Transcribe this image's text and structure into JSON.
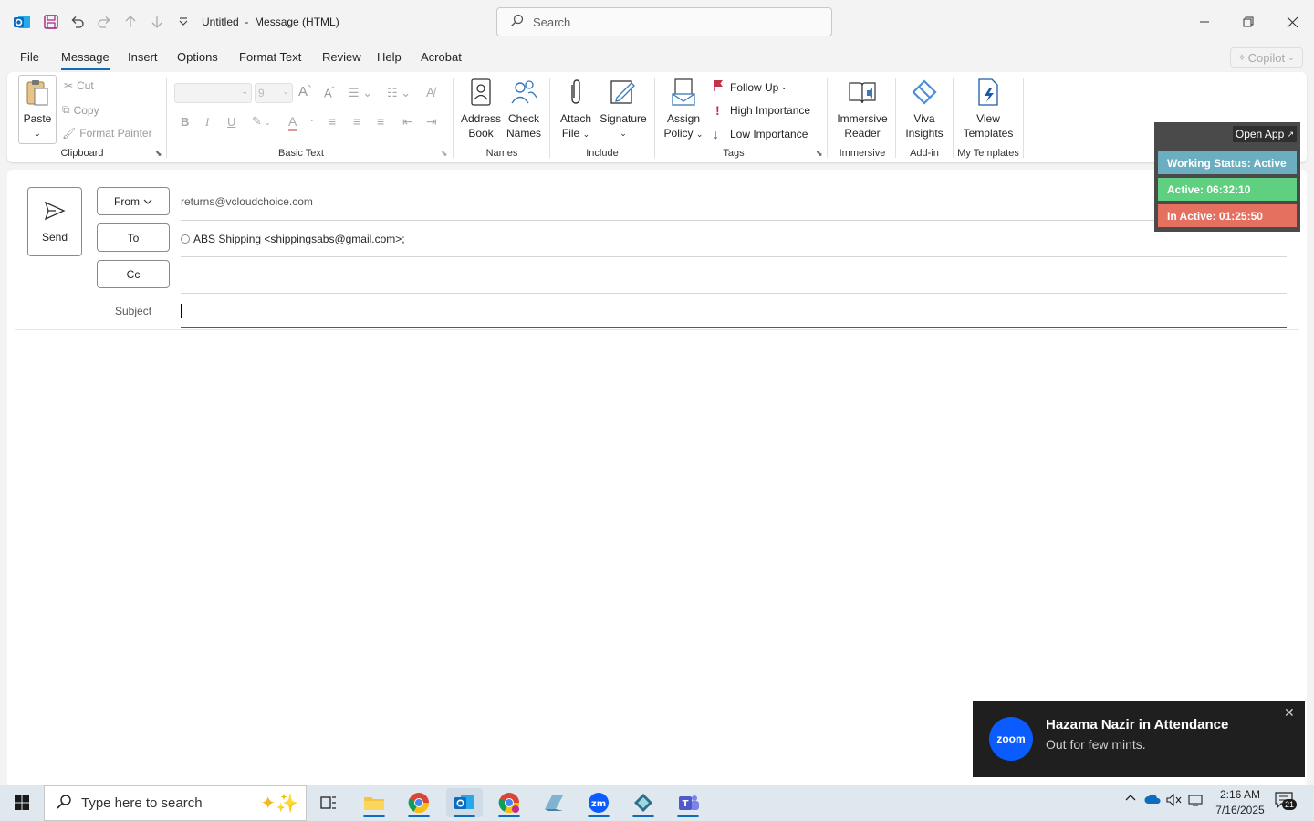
{
  "titlebar": {
    "title": "Untitled",
    "separator": "-",
    "subtitle": "Message (HTML)",
    "search_placeholder": "Search"
  },
  "menu": {
    "tabs": [
      "File",
      "Message",
      "Insert",
      "Options",
      "Format Text",
      "Review",
      "Help",
      "Acrobat"
    ],
    "active": "Message",
    "copilot": "Copilot"
  },
  "ribbon": {
    "clipboard": {
      "paste": "Paste",
      "cut": "Cut",
      "copy": "Copy",
      "format_painter": "Format Painter",
      "label": "Clipboard"
    },
    "basic_text": {
      "font_size": "9",
      "label": "Basic Text"
    },
    "names": {
      "address_book": [
        "Address",
        "Book"
      ],
      "check_names": [
        "Check",
        "Names"
      ],
      "label": "Names"
    },
    "include": {
      "attach_file": [
        "Attach",
        "File"
      ],
      "signature": "Signature",
      "label": "Include"
    },
    "tags": {
      "assign_policy": [
        "Assign",
        "Policy"
      ],
      "follow_up": "Follow Up",
      "high_importance": "High Importance",
      "low_importance": "Low Importance",
      "label": "Tags"
    },
    "immersive": {
      "reader": [
        "Immersive",
        "Reader"
      ],
      "label": "Immersive"
    },
    "addin": {
      "viva": [
        "Viva",
        "Insights"
      ],
      "label": "Add-in"
    },
    "templates": {
      "view": [
        "View",
        "Templates"
      ],
      "label": "My Templates"
    }
  },
  "compose": {
    "send": "Send",
    "from_label": "From",
    "from_value": "returns@vcloudchoice.com",
    "to_label": "To",
    "to_value": "ABS Shipping <shippingsabs@gmail.com>;",
    "cc_label": "Cc",
    "subject_label": "Subject"
  },
  "status_widget": {
    "open_app": "Open App",
    "working": "Working Status: Active",
    "active": "Active: 06:32:10",
    "inactive": "In Active: 01:25:50",
    "colors": {
      "working": "#6aaebf",
      "active": "#5fcf80",
      "inactive": "#e5705f"
    }
  },
  "toast": {
    "logo": "zoom",
    "title": "Hazama Nazir in Attendance",
    "message": "Out for few mints."
  },
  "taskbar": {
    "search_placeholder": "Type here to search",
    "time": "2:16 AM",
    "date": "7/16/2025",
    "notifications": "21"
  },
  "accent": "#0f6cbd"
}
